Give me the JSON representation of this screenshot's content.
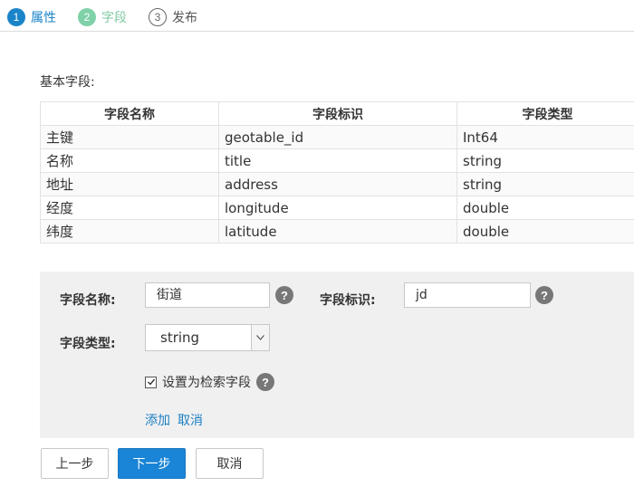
{
  "steps": [
    {
      "num": "1",
      "label": "属性"
    },
    {
      "num": "2",
      "label": "字段"
    },
    {
      "num": "3",
      "label": "发布"
    }
  ],
  "section_title": "基本字段:",
  "table": {
    "headers": [
      "字段名称",
      "字段标识",
      "字段类型"
    ],
    "rows": [
      [
        "主键",
        "geotable_id",
        "Int64"
      ],
      [
        "名称",
        "title",
        "string"
      ],
      [
        "地址",
        "address",
        "string"
      ],
      [
        "经度",
        "longitude",
        "double"
      ],
      [
        "纬度",
        "latitude",
        "double"
      ]
    ]
  },
  "form": {
    "name_label": "字段名称:",
    "name_value": "街道",
    "key_label": "字段标识:",
    "key_value": "jd",
    "type_label": "字段类型:",
    "type_value": "string",
    "help_glyph": "?",
    "searchable_label": "设置为检索字段",
    "searchable_checked": true,
    "add_link": "添加",
    "cancel_link": "取消"
  },
  "buttons": {
    "prev": "上一步",
    "next": "下一步",
    "cancel": "取消"
  },
  "icons": {
    "help": "question-circle-icon",
    "dropdown": "chevron-down-icon",
    "check": "checkmark-icon"
  },
  "colors": {
    "primary": "#1a84d6",
    "step_active": "#1a84c9",
    "step_done": "#7fd1a8",
    "link": "#1a7fc4",
    "panel_bg": "#f0f0f0"
  }
}
